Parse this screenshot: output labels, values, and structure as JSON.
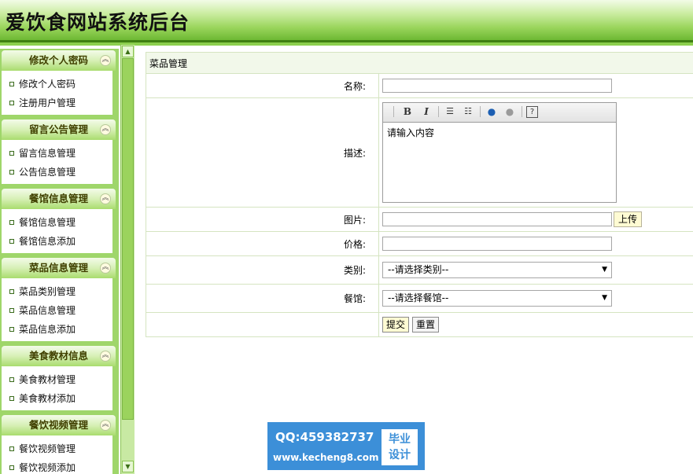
{
  "header": {
    "title": "爱饮食网站系统后台"
  },
  "sidebar": {
    "groups": [
      {
        "title": "修改个人密码",
        "items": [
          "修改个人密码",
          "注册用户管理"
        ]
      },
      {
        "title": "留言公告管理",
        "items": [
          "留言信息管理",
          "公告信息管理"
        ]
      },
      {
        "title": "餐馆信息管理",
        "items": [
          "餐馆信息管理",
          "餐馆信息添加"
        ]
      },
      {
        "title": "菜品信息管理",
        "items": [
          "菜品类别管理",
          "菜品信息管理",
          "菜品信息添加"
        ]
      },
      {
        "title": "美食教材信息",
        "items": [
          "美食教材管理",
          "美食教材添加"
        ]
      },
      {
        "title": "餐饮视频管理",
        "items": [
          "餐饮视频管理",
          "餐饮视频添加"
        ]
      }
    ],
    "toggle_icon": "chevron-up-icon"
  },
  "form": {
    "heading": "菜品管理",
    "name_label": "名称:",
    "name_value": "",
    "desc_label": "描述:",
    "editor_content": "请输入内容",
    "image_label": "图片:",
    "image_value": "",
    "upload_button": "上传",
    "price_label": "价格:",
    "price_value": "",
    "category_label": "类别:",
    "category_selected": "--请选择类别--",
    "restaurant_label": "餐馆:",
    "restaurant_selected": "--请选择餐馆--",
    "submit_button": "提交",
    "reset_button": "重置"
  },
  "editor_toolbar": {
    "bold": "B",
    "italic": "I",
    "icons": [
      "bold-icon",
      "italic-icon",
      "ordered-list-icon",
      "unordered-list-icon",
      "link-icon",
      "unlink-icon",
      "help-icon"
    ]
  },
  "watermark": {
    "qq": "QQ:459382737",
    "url": "www.kecheng8.com",
    "badge_line1": "毕业",
    "badge_line2": "设计"
  },
  "colors": {
    "header_green": "#8ccf4e",
    "header_dark": "#3f7f12",
    "sidebar_green": "#9fd66a",
    "watermark_blue": "#3c8fd8"
  }
}
